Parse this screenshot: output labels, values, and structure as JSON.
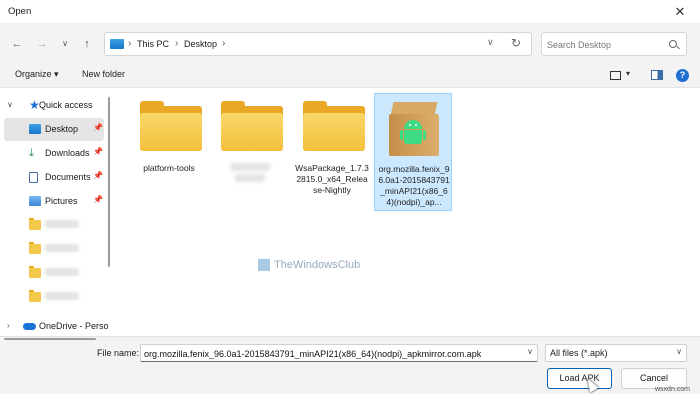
{
  "window": {
    "title": "Open",
    "close_glyph": "✕"
  },
  "address": {
    "crumbs": [
      "This PC",
      "Desktop"
    ],
    "refresh_glyph": "↻"
  },
  "search": {
    "placeholder": "Search Desktop"
  },
  "toolbar": {
    "organize": "Organize",
    "new_folder": "New folder",
    "help": "?"
  },
  "sidebar": {
    "items": [
      {
        "label": "Quick access",
        "icon": "star-icon",
        "expander": "∨"
      },
      {
        "label": "Desktop",
        "icon": "desktop-icon",
        "pinned": true,
        "selected": true
      },
      {
        "label": "Downloads",
        "icon": "download-icon",
        "pinned": true
      },
      {
        "label": "Documents",
        "icon": "document-icon",
        "pinned": true
      },
      {
        "label": "Pictures",
        "icon": "pictures-icon",
        "pinned": true
      },
      {
        "label": "",
        "icon": "folder-icon",
        "blurred": true
      },
      {
        "label": "",
        "icon": "folder-icon",
        "blurred": true
      },
      {
        "label": "",
        "icon": "folder-icon",
        "blurred": true
      },
      {
        "label": "",
        "icon": "folder-icon",
        "blurred": true
      },
      {
        "label": "OneDrive - Perso",
        "icon": "onedrive-icon",
        "expander": "›"
      }
    ]
  },
  "files": [
    {
      "name": "platform-tools",
      "type": "folder"
    },
    {
      "name": "",
      "type": "folder",
      "blurred": true
    },
    {
      "name": "WsaPackage_1.7.32815.0_x64_Release-Nightly",
      "type": "folder"
    },
    {
      "name": "org.mozilla.fenix_96.0a1-2015843791_minAPI21(x86_64)(nodpi)_ap...",
      "type": "apk",
      "selected": true
    }
  ],
  "watermark": "TheWindowsClub",
  "footer": {
    "file_name_label": "File name:",
    "file_name_value": "org.mozilla.fenix_96.0a1-2015843791_minAPI21(x86_64)(nodpi)_apkmirror.com.apk",
    "file_type": "All files (*.apk)",
    "open_button": "Load APK",
    "cancel_button": "Cancel"
  },
  "site_watermark": "wsxdn.com"
}
